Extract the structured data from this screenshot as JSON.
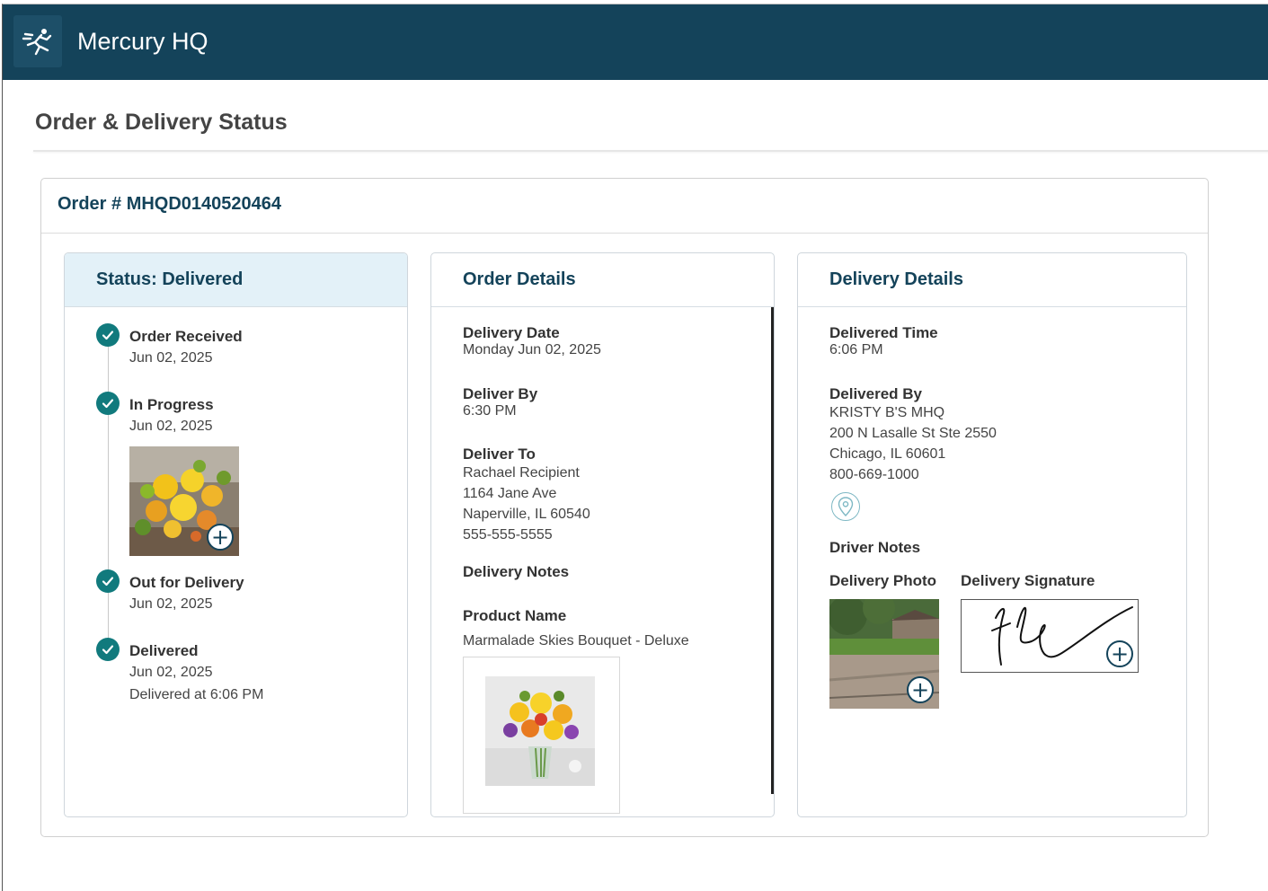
{
  "header": {
    "app_title": "Mercury HQ",
    "logo_icon": "mercury-runner-icon"
  },
  "page": {
    "title": "Order & Delivery Status"
  },
  "order": {
    "number_label": "Order # MHQD0140520464"
  },
  "status_panel": {
    "title": "Status: Delivered",
    "steps": [
      {
        "name": "Order Received",
        "date": "Jun 02, 2025"
      },
      {
        "name": "In Progress",
        "date": "Jun 02, 2025"
      },
      {
        "name": "Out for Delivery",
        "date": "Jun 02, 2025"
      },
      {
        "name": "Delivered",
        "date": "Jun 02, 2025",
        "extra": "Delivered at 6:06 PM"
      }
    ]
  },
  "order_details": {
    "title": "Order Details",
    "delivery_date_label": "Delivery Date",
    "delivery_date": "Monday Jun 02, 2025",
    "deliver_by_label": "Deliver By",
    "deliver_by": "6:30 PM",
    "deliver_to_label": "Deliver To",
    "recipient": "Rachael Recipient",
    "address1": "1164 Jane Ave",
    "address2": "Naperville, IL 60540",
    "phone": "555-555-5555",
    "delivery_notes_label": "Delivery Notes",
    "product_name_label": "Product Name",
    "product_name": "Marmalade Skies Bouquet - Deluxe"
  },
  "delivery_details": {
    "title": "Delivery Details",
    "delivered_time_label": "Delivered Time",
    "delivered_time": "6:06 PM",
    "delivered_by_label": "Delivered By",
    "shop_name": "KRISTY B'S MHQ",
    "shop_address1": "200 N Lasalle St Ste 2550",
    "shop_address2": "Chicago, IL 60601",
    "shop_phone": "800-669-1000",
    "driver_notes_label": "Driver Notes",
    "delivery_photo_label": "Delivery Photo",
    "delivery_signature_label": "Delivery Signature"
  },
  "colors": {
    "header_bg": "#14435a",
    "accent_teal": "#117a7d",
    "status_head_bg": "#e3f1f8"
  }
}
